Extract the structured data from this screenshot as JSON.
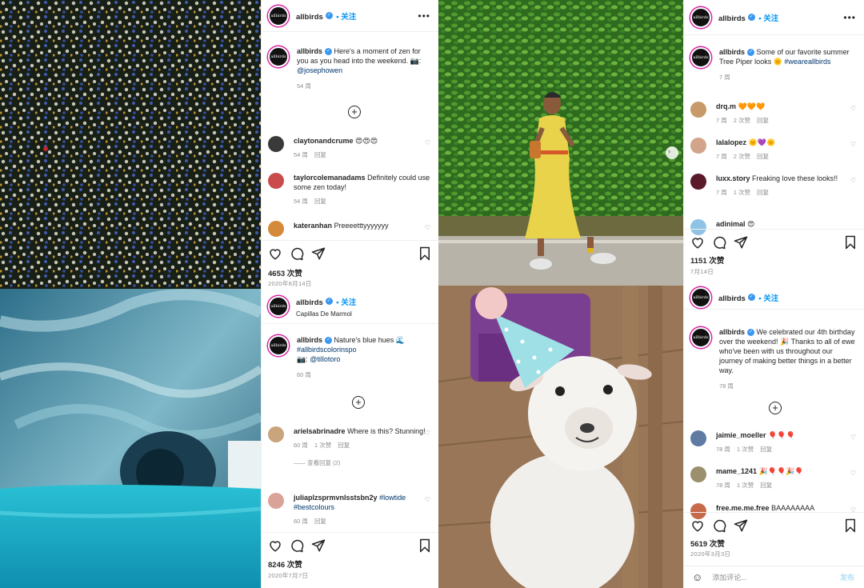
{
  "posts": [
    {
      "username": "allbirds",
      "follow": "• 关注",
      "caption_text": "Here's a moment of zen for you as you head into the weekend. 📷:",
      "caption_link": "@josephowen",
      "caption_time": "54 周",
      "comments": [
        {
          "user": "claytonandcrume",
          "text": "😍😍😍",
          "time": "54 周",
          "reply": "回复"
        },
        {
          "user": "taylorcolemanadams",
          "text": "Definitely could use some zen today!",
          "time": "54 周",
          "reply": "回复"
        },
        {
          "user": "kateranhan",
          "text": "Preeeetttyyyyyyy"
        }
      ],
      "likes": "4653 次赞",
      "date": "2020年8月14日"
    },
    {
      "username": "allbirds",
      "follow": "• 关注",
      "caption_text": "Some of our favorite summer Tree Piper looks 🌞",
      "caption_link": "#weareallbirds",
      "caption_time": "7 周",
      "comments": [
        {
          "user": "drq.m",
          "text": "🧡🧡🧡",
          "time": "7 周",
          "likes": "2 次赞",
          "reply": "回复"
        },
        {
          "user": "lalalopez",
          "text": "🌞💜🌞",
          "time": "7 周",
          "likes": "2 次赞",
          "reply": "回复"
        },
        {
          "user": "luxx.story",
          "text": "Freaking love these looks!!",
          "time": "7 周",
          "likes": "1 次赞",
          "reply": "回复"
        },
        {
          "user": "adinimal",
          "text": "😍"
        }
      ],
      "likes": "1151 次赞",
      "date": "7月14日"
    },
    {
      "username": "allbirds",
      "follow": "• 关注",
      "location": "Capillas De Marmol",
      "caption_text": "Nature's blue hues 🌊",
      "caption_link": "#allbirdscolorinspo",
      "caption_credit": "📷:",
      "caption_link2": "@tillotoro",
      "caption_time": "60 周",
      "comments": [
        {
          "user": "arielsabrinadre",
          "text": "Where is this? Stunning!",
          "time": "60 周",
          "likes": "1 次赞",
          "reply": "回复",
          "view_replies": "—— 查看回复 (2)"
        },
        {
          "user": "juliaplzsprmvnlsstsbn2y",
          "text": "",
          "link": "#lowtide #bestcolours",
          "time": "60 周",
          "reply": "回复"
        }
      ],
      "likes": "8246 次赞",
      "date": "2020年7月7日"
    },
    {
      "username": "allbirds",
      "follow": "• 关注",
      "caption_text": "We celebrated our 4th birthday over the weekend! 🎉 Thanks to all of ewe who've been with us throughout our journey of making better things in a better way.",
      "caption_time": "78 周",
      "comments": [
        {
          "user": "jaimie_moeller",
          "text": "🎈🎈🎈",
          "time": "78 周",
          "likes": "1 次赞",
          "reply": "回复"
        },
        {
          "user": "mame_1241",
          "text": "🎉🎈🎈🎉🎈",
          "time": "78 周",
          "likes": "1 次赞",
          "reply": "回复"
        },
        {
          "user": "free.me.me.free",
          "text": "BAAAAAAAA"
        }
      ],
      "likes": "5619 次赞",
      "date": "2020年3月3日",
      "comment_placeholder": "添加评论...",
      "post_button": "发布"
    }
  ],
  "avatar_text": "allbirds",
  "icons": [
    "heart-icon",
    "comment-icon",
    "share-icon",
    "bookmark-icon",
    "more-icon",
    "plus-circle-icon",
    "emoji-icon",
    "verified-icon",
    "next-arrow-icon"
  ]
}
